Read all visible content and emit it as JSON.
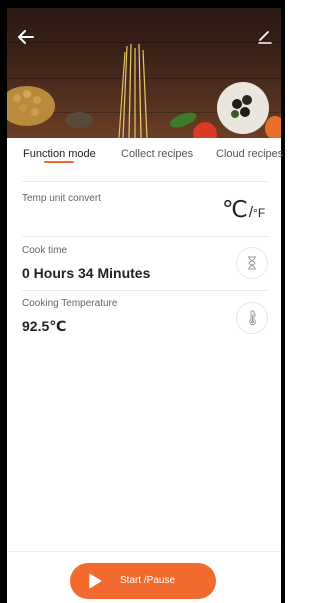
{
  "colors": {
    "accent": "#f26a2e",
    "hero_background": "#3b2218"
  },
  "header": {
    "back_icon": "arrow-left-icon",
    "edit_icon": "pencil-icon"
  },
  "tabs": [
    {
      "label": "Function mode",
      "active": true
    },
    {
      "label": "Collect recipes",
      "active": false
    },
    {
      "label": "Cloud recipes",
      "active": false
    }
  ],
  "settings": {
    "temp_unit": {
      "label": "Temp unit convert",
      "celsius": "℃",
      "separator": "/",
      "fahrenheit": "°F"
    },
    "cook_time": {
      "label": "Cook time",
      "value": "0 Hours 34 Minutes",
      "icon": "hourglass-icon"
    },
    "cooking_temperature": {
      "label": "Cooking Temperature",
      "value": "92.5℃",
      "icon": "thermometer-icon"
    }
  },
  "footer": {
    "start_label": "Start /Pause",
    "icon": "play-icon"
  }
}
